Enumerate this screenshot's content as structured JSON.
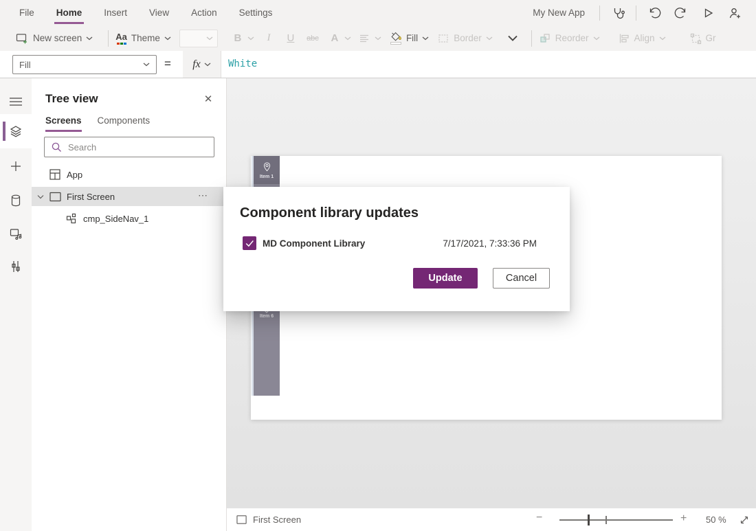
{
  "menu": {
    "items": [
      {
        "label": "File"
      },
      {
        "label": "Home"
      },
      {
        "label": "Insert"
      },
      {
        "label": "View"
      },
      {
        "label": "Action"
      },
      {
        "label": "Settings"
      }
    ],
    "app_title": "My New App"
  },
  "toolbar": {
    "new_screen_label": "New screen",
    "theme_icon_text": "Aa",
    "theme_label": "Theme",
    "bold_label": "B",
    "italic_label": "I",
    "underline_label": "U",
    "strikethrough_label": "abc",
    "font_color_label": "A",
    "fill_label": "Fill",
    "border_label": "Border",
    "reorder_label": "Reorder",
    "align_label": "Align",
    "group_label": "Gr"
  },
  "formula_bar": {
    "property_value": "Fill",
    "equals_sign": "=",
    "fx_label": "fx",
    "formula_text": "White"
  },
  "tree_panel": {
    "title": "Tree view",
    "close_glyph": "✕",
    "tabs": [
      {
        "label": "Screens"
      },
      {
        "label": "Components"
      }
    ],
    "search_placeholder": "Search",
    "rows": [
      {
        "label": "App"
      },
      {
        "label": "First Screen"
      },
      {
        "label": "cmp_SideNav_1"
      }
    ],
    "ellipsis_glyph": "⋯"
  },
  "canvas": {
    "sidenav": {
      "item_top": "Item 1",
      "item_bottom": "Item 6"
    }
  },
  "dialog": {
    "title": "Component library updates",
    "library_name": "MD Component Library",
    "timestamp": "7/17/2021, 7:33:36 PM",
    "update_label": "Update",
    "cancel_label": "Cancel"
  },
  "status_bar": {
    "screen_label": "First Screen",
    "minus_glyph": "−",
    "plus_glyph": "+",
    "zoom_text": "50 %"
  },
  "colors": {
    "accent_purple": "#742774",
    "tab_underline": "#955a94",
    "formula_teal": "#2ba0a6",
    "sidenav_bar": "#8a8795",
    "sidenav_item": "#716e7c",
    "selected_row": "#e1e1e1"
  }
}
